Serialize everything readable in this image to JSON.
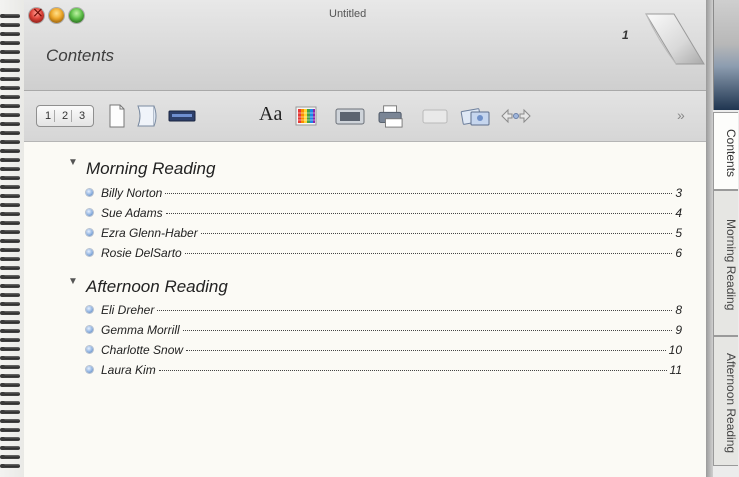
{
  "window": {
    "title": "Untitled"
  },
  "header": {
    "heading": "Contents",
    "page_number": "1"
  },
  "toolbar": {
    "numbering_labels": [
      "1",
      "2",
      "3"
    ],
    "font_label": "Aa",
    "more_label": "»",
    "icons": [
      "numbering-icon",
      "page-icon",
      "notebook-icon",
      "ruler-icon",
      "font-icon",
      "color-grid-icon",
      "media-icon",
      "print-icon",
      "blank-icon",
      "photos-icon",
      "arrows-icon",
      "more-icon"
    ]
  },
  "sections": [
    {
      "title": "Morning Reading",
      "entries": [
        {
          "name": "Billy Norton",
          "page": "3"
        },
        {
          "name": "Sue Adams",
          "page": "4"
        },
        {
          "name": "Ezra Glenn-Haber",
          "page": "5"
        },
        {
          "name": "Rosie DelSarto",
          "page": "6"
        }
      ]
    },
    {
      "title": "Afternoon Reading",
      "entries": [
        {
          "name": "Eli Dreher",
          "page": "8"
        },
        {
          "name": "Gemma Morrill",
          "page": "9"
        },
        {
          "name": "Charlotte Snow",
          "page": "10"
        },
        {
          "name": "Laura Kim",
          "page": "11"
        }
      ]
    }
  ],
  "side_tabs": [
    "Contents",
    "Morning Reading",
    "Afternoon Reading"
  ]
}
